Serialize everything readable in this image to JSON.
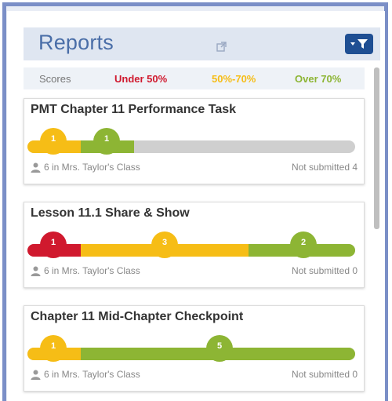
{
  "header": {
    "title": "Reports"
  },
  "legend": {
    "scores": "Scores",
    "under": "Under 50%",
    "mid": "50%-70%",
    "over": "Over 70%"
  },
  "colors": {
    "red": "#d0192e",
    "yellow": "#f6bd16",
    "green": "#8db534",
    "gray": "#cfcfcf"
  },
  "reports": [
    {
      "title": "PMT Chapter 11 Performance Task",
      "class_text": "6 in Mrs. Taylor's Class",
      "not_submitted": "Not submitted 4",
      "counts": {
        "under": "",
        "mid": "1",
        "over": "1"
      }
    },
    {
      "title": "Lesson 11.1 Share & Show",
      "class_text": "6 in Mrs. Taylor's Class",
      "not_submitted": "Not submitted 0",
      "counts": {
        "under": "1",
        "mid": "3",
        "over": "2"
      }
    },
    {
      "title": "Chapter 11 Mid-Chapter Checkpoint",
      "class_text": "6 in Mrs. Taylor's Class",
      "not_submitted": "Not submitted 0",
      "counts": {
        "under": "",
        "mid": "1",
        "over": "5"
      }
    }
  ]
}
